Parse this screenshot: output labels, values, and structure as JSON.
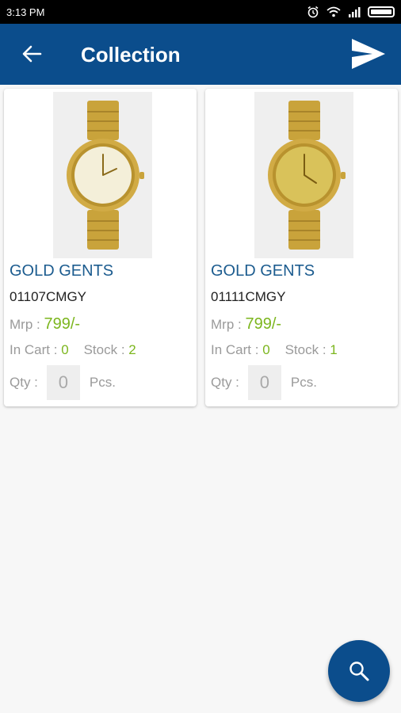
{
  "status_bar": {
    "time": "3:13 PM"
  },
  "app_bar": {
    "title": "Collection"
  },
  "products": [
    {
      "name": "GOLD GENTS",
      "code": "01107CMGY",
      "mrp_label": "Mrp :",
      "mrp_value": "799/-",
      "in_cart_label": "In Cart :",
      "in_cart_value": "0",
      "stock_label": "Stock :",
      "stock_value": "2",
      "qty_label": "Qty :",
      "qty_value": "0",
      "pcs_label": "Pcs.",
      "dial_color": "#f4efd9"
    },
    {
      "name": "GOLD GENTS",
      "code": "01111CMGY",
      "mrp_label": "Mrp :",
      "mrp_value": "799/-",
      "in_cart_label": "In Cart :",
      "in_cart_value": "0",
      "stock_label": "Stock :",
      "stock_value": "1",
      "qty_label": "Qty :",
      "qty_value": "0",
      "pcs_label": "Pcs.",
      "dial_color": "#d9c25a"
    }
  ],
  "colors": {
    "primary": "#0b4d8c",
    "accent_green": "#7cb61e",
    "product_name": "#1c5c8f"
  },
  "icons": {
    "back": "arrow-left-icon",
    "send": "send-icon",
    "search": "search-icon"
  }
}
